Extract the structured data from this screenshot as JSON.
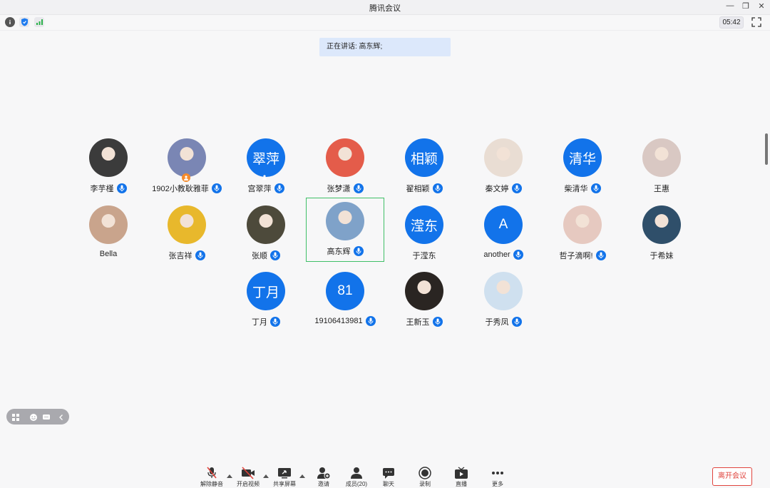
{
  "window": {
    "title": "腾讯会议",
    "timer": "05:42"
  },
  "speaking": "正在讲话: 高东辉;",
  "participants": [
    {
      "name": "李芋槿",
      "avatar_text": "",
      "avatar_color": "#3b3b3b",
      "mic": true
    },
    {
      "name": "1902小教耿雅菲",
      "avatar_text": "",
      "avatar_color": "#7a86b4",
      "mic": true
    },
    {
      "name": "宫翠萍",
      "avatar_text": "翠萍",
      "avatar_color": "#1273ea",
      "mic": true
    },
    {
      "name": "张梦潇",
      "avatar_text": "",
      "avatar_color": "#e45c4a",
      "mic": true
    },
    {
      "name": "翟相颖",
      "avatar_text": "相颖",
      "avatar_color": "#1273ea",
      "mic": true
    },
    {
      "name": "秦文婷",
      "avatar_text": "",
      "avatar_color": "#e9ddd3",
      "mic": true
    },
    {
      "name": "柴清华",
      "avatar_text": "清华",
      "avatar_color": "#1273ea",
      "mic": true
    },
    {
      "name": "王惠",
      "avatar_text": "",
      "avatar_color": "#d9c8c3",
      "mic": false
    },
    {
      "name": "Bella",
      "avatar_text": "",
      "avatar_color": "#c9a48c",
      "mic": false
    },
    {
      "name": "张吉祥",
      "avatar_text": "",
      "avatar_color": "#e8b82c",
      "mic": true
    },
    {
      "name": "张顺",
      "avatar_text": "",
      "avatar_color": "#4d4a3b",
      "mic": true
    },
    {
      "name": "高东辉",
      "avatar_text": "",
      "avatar_color": "#7fa2c9",
      "mic": true
    },
    {
      "name": "于滢东",
      "avatar_text": "滢东",
      "avatar_color": "#1273ea",
      "mic": false
    },
    {
      "name": "another",
      "avatar_text": "A",
      "avatar_color": "#1273ea",
      "mic": true
    },
    {
      "name": "哲子滴啊!",
      "avatar_text": "",
      "avatar_color": "#e6c9c0",
      "mic": true
    },
    {
      "name": "于希妹",
      "avatar_text": "",
      "avatar_color": "#2f4f6a",
      "mic": false
    },
    {
      "name": "丁月",
      "avatar_text": "丁月",
      "avatar_color": "#1273ea",
      "mic": true
    },
    {
      "name": "19106413981",
      "avatar_text": "81",
      "avatar_color": "#1273ea",
      "mic": true
    },
    {
      "name": "王新玉",
      "avatar_text": "",
      "avatar_color": "#2a2522",
      "mic": true
    },
    {
      "name": "于秀凤",
      "avatar_text": "",
      "avatar_color": "#cfe0ef",
      "mic": true
    }
  ],
  "bottom_bar": {
    "unmute": "解除静音",
    "video": "开启视频",
    "share": "共享屏幕",
    "invite": "邀请",
    "members": "成员(20)",
    "chat": "聊天",
    "record": "录制",
    "live": "直播",
    "more": "更多",
    "leave": "离开会议"
  },
  "colors": {
    "accent": "#1273ea",
    "active_border": "#3fbf67",
    "leave": "#e0443d"
  }
}
